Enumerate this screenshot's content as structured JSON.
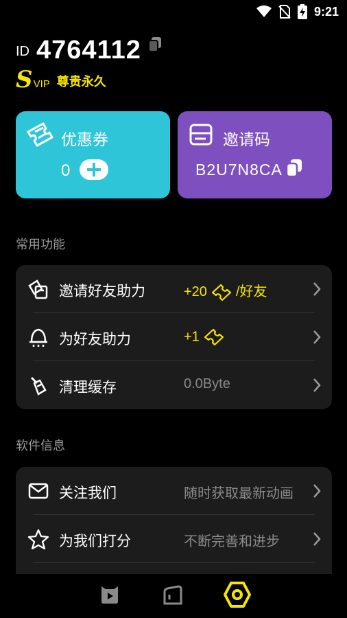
{
  "status_bar": {
    "time": "9:21"
  },
  "profile": {
    "id_label": "ID",
    "id_number": "4764112",
    "svip_s": "S",
    "svip_vip": "VIP",
    "vip_text": "尊贵永久"
  },
  "cards": {
    "coupon": {
      "title": "优惠券",
      "value": "0"
    },
    "invite": {
      "title": "邀请码",
      "code": "B2U7N8CA"
    }
  },
  "common_section": {
    "title": "常用功能",
    "items": [
      {
        "label": "邀请好友助力",
        "value": "+20",
        "suffix": "/好友",
        "icon": "invite-friend-icon"
      },
      {
        "label": "为好友助力",
        "value": "+1",
        "suffix": "",
        "icon": "help-friend-icon"
      },
      {
        "label": "清理缓存",
        "value": "0.0Byte",
        "suffix": "",
        "icon": "clear-cache-icon"
      }
    ]
  },
  "info_section": {
    "title": "软件信息",
    "items": [
      {
        "label": "关注我们",
        "value": "随时获取最新动画",
        "icon": "mail-icon"
      },
      {
        "label": "为我们打分",
        "value": "不断完善和进步",
        "icon": "star-icon"
      }
    ]
  },
  "nav": {
    "items": [
      {
        "icon": "video-icon"
      },
      {
        "icon": "bookmark-icon"
      },
      {
        "icon": "settings-icon",
        "active": true
      }
    ]
  },
  "colors": {
    "accent_yellow": "#f7e600",
    "coupon_card": "#2ec5d8",
    "invite_card": "#7e4fbf",
    "panel_bg": "#1c1c1c"
  }
}
